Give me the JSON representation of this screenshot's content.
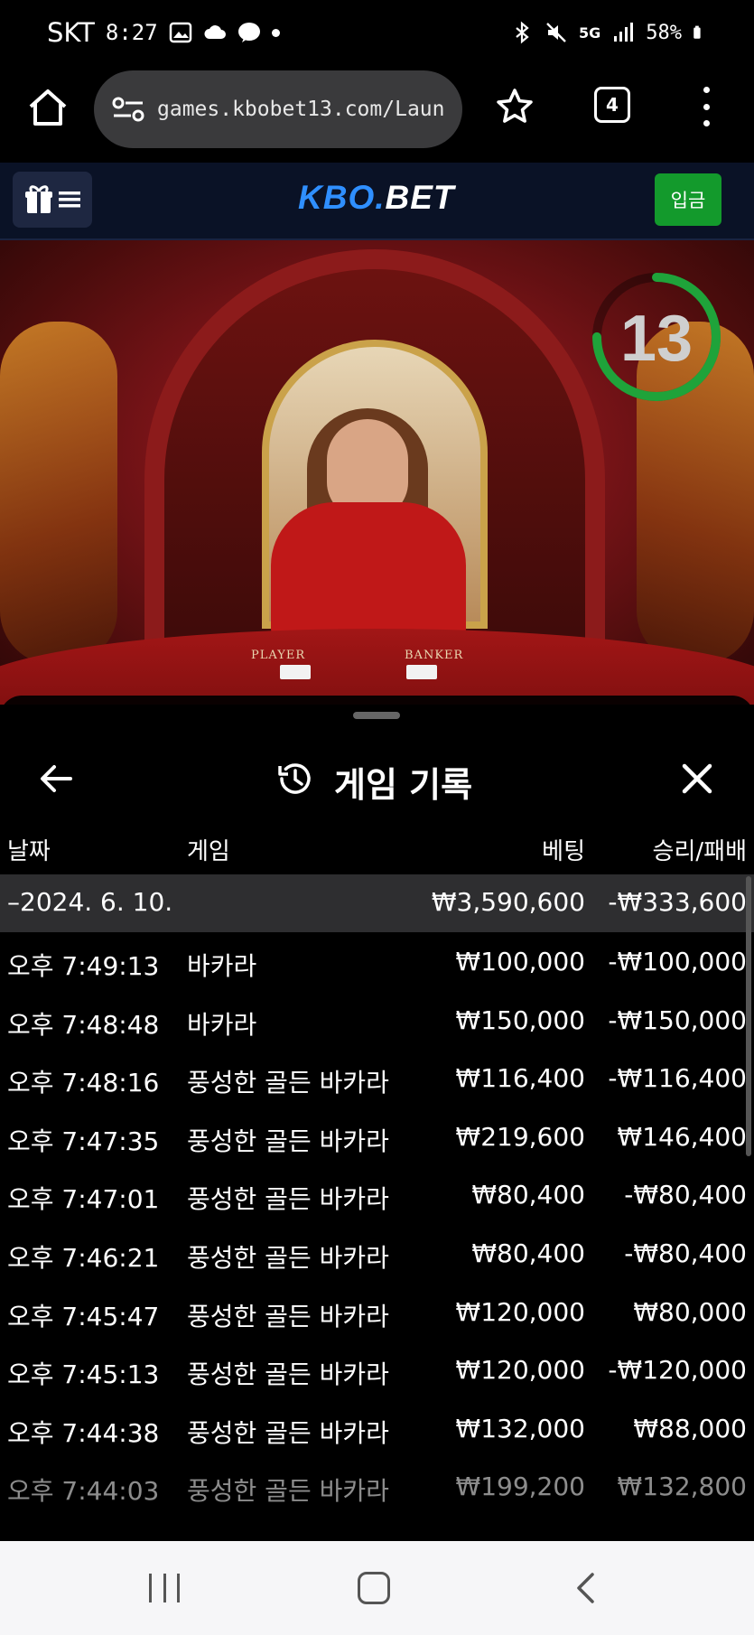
{
  "status_bar": {
    "carrier": "SKT",
    "time": "8:27",
    "network": "5G",
    "battery": "58%"
  },
  "browser": {
    "url": "games.kbobet13.com/Laun",
    "tab_count": "4"
  },
  "site_header": {
    "logo_kbo": "KBO",
    "logo_dot": ".",
    "logo_bet": "BET",
    "deposit_label": "입금"
  },
  "video": {
    "timer_value": "13",
    "timer_fraction": 0.75,
    "label_player": "PLAYER",
    "label_banker": "BANKER",
    "accent_color": "#1fa33a"
  },
  "history": {
    "title": "게임 기록",
    "columns": {
      "date": "날짜",
      "game": "게임",
      "bet": "베팅",
      "result": "승리/패배"
    },
    "date_group": {
      "date": "–2024. 6. 10.",
      "total_bet": "₩3,590,600",
      "total_result": "-₩333,600"
    },
    "rows": [
      {
        "time": "오후 7:49:13",
        "game": "바카라",
        "bet": "₩100,000",
        "result": "-₩100,000"
      },
      {
        "time": "오후 7:48:48",
        "game": "바카라",
        "bet": "₩150,000",
        "result": "-₩150,000"
      },
      {
        "time": "오후 7:48:16",
        "game": "풍성한 골든 바카라",
        "bet": "₩116,400",
        "result": "-₩116,400"
      },
      {
        "time": "오후 7:47:35",
        "game": "풍성한 골든 바카라",
        "bet": "₩219,600",
        "result": "₩146,400"
      },
      {
        "time": "오후 7:47:01",
        "game": "풍성한 골든 바카라",
        "bet": "₩80,400",
        "result": "-₩80,400"
      },
      {
        "time": "오후 7:46:21",
        "game": "풍성한 골든 바카라",
        "bet": "₩80,400",
        "result": "-₩80,400"
      },
      {
        "time": "오후 7:45:47",
        "game": "풍성한 골든 바카라",
        "bet": "₩120,000",
        "result": "₩80,000"
      },
      {
        "time": "오후 7:45:13",
        "game": "풍성한 골든 바카라",
        "bet": "₩120,000",
        "result": "-₩120,000"
      },
      {
        "time": "오후 7:44:38",
        "game": "풍성한 골든 바카라",
        "bet": "₩132,000",
        "result": "₩88,000"
      },
      {
        "time": "오후 7:44:03",
        "game": "풍성한 골든 바카라",
        "bet": "₩199,200",
        "result": "₩132,800"
      }
    ]
  }
}
